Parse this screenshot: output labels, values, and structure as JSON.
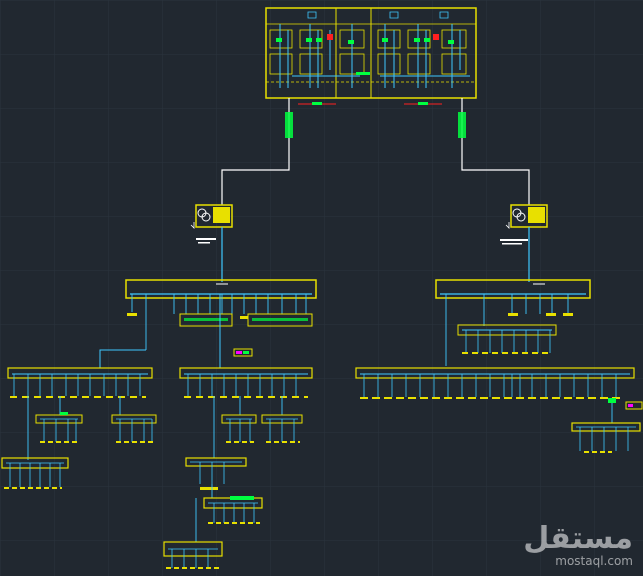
{
  "watermark": {
    "arabic": "مستقل",
    "latin": "mostaql.com"
  },
  "colors": {
    "background": "#212830",
    "grid": "#2a323b",
    "panel": "#e8e000",
    "busbar": "#e8e000",
    "feeder": "#3ec8ff",
    "cable": "#ffffff",
    "breaker": "#00ff40",
    "label": "#ffd700",
    "accent_red": "#ff2020",
    "accent_magenta": "#ff00ff"
  }
}
